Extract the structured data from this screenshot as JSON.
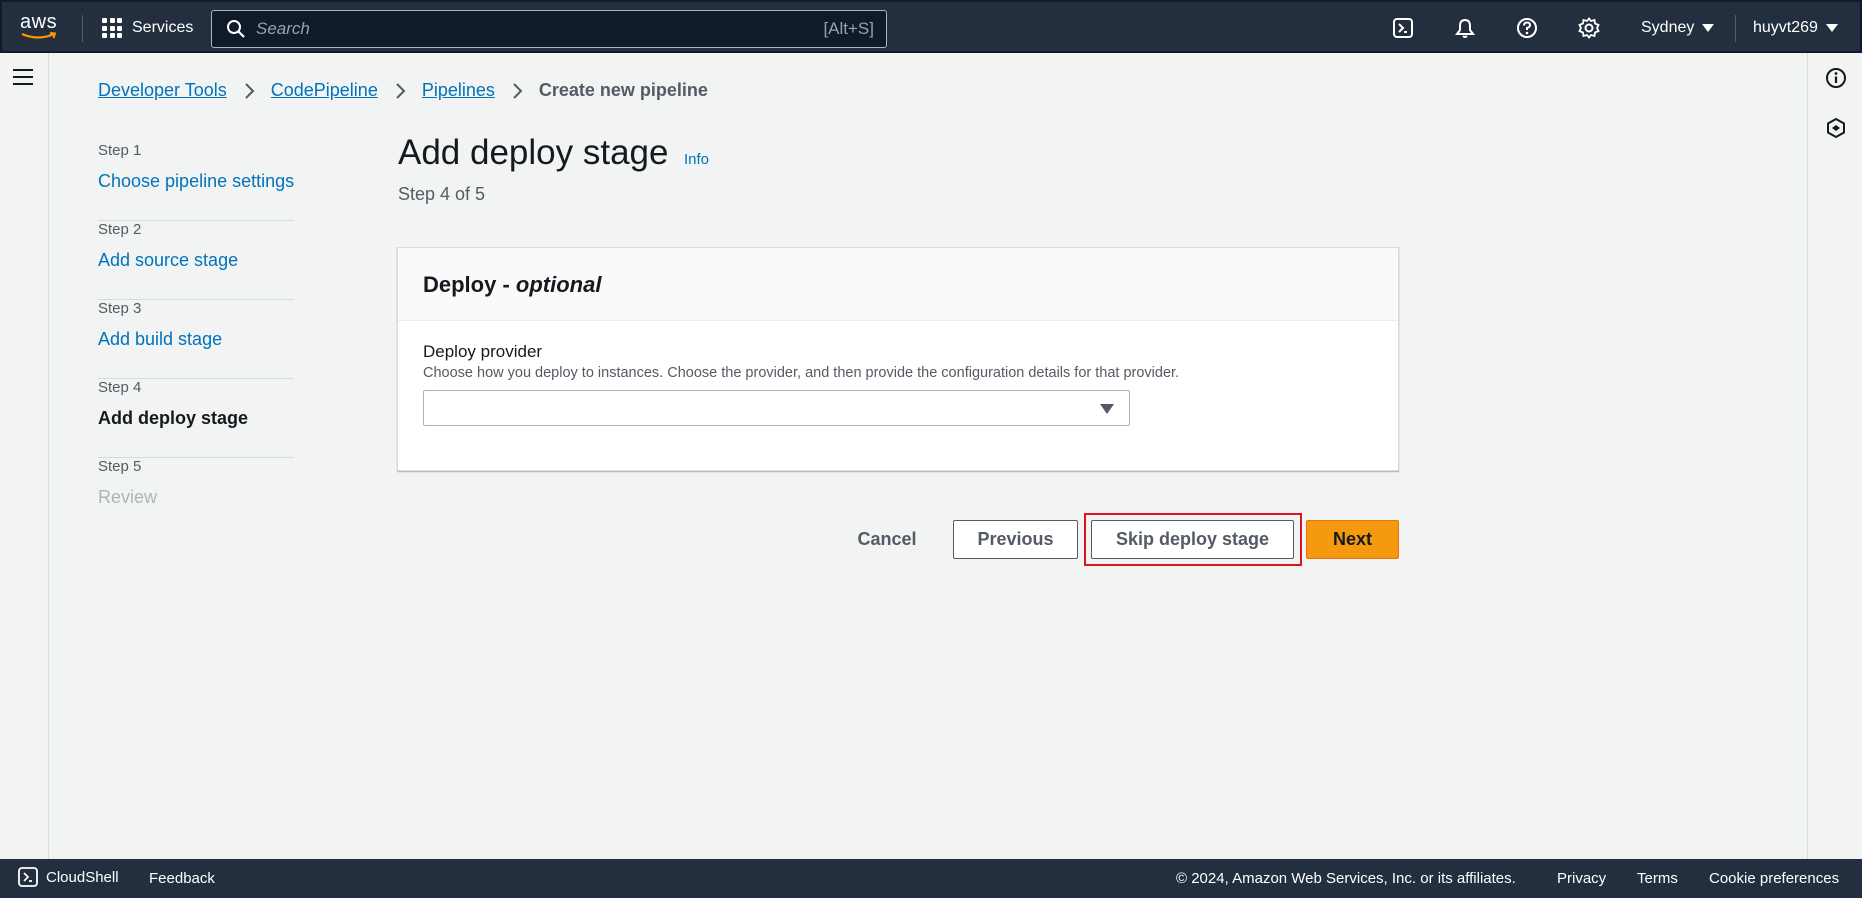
{
  "topnav": {
    "logo_text": "aws",
    "services_label": "Services",
    "search_placeholder": "Search",
    "search_shortcut": "[Alt+S]",
    "region": "Sydney",
    "user": "huyvt269"
  },
  "breadcrumb": {
    "items": [
      "Developer Tools",
      "CodePipeline",
      "Pipelines"
    ],
    "current": "Create new pipeline"
  },
  "steps": [
    {
      "num": "Step 1",
      "label": "Choose pipeline settings",
      "state": "link"
    },
    {
      "num": "Step 2",
      "label": "Add source stage",
      "state": "link"
    },
    {
      "num": "Step 3",
      "label": "Add build stage",
      "state": "link"
    },
    {
      "num": "Step 4",
      "label": "Add deploy stage",
      "state": "active"
    },
    {
      "num": "Step 5",
      "label": "Review",
      "state": "disabled"
    }
  ],
  "page": {
    "title": "Add deploy stage",
    "info": "Info",
    "step_of": "Step 4 of 5"
  },
  "panel": {
    "title_main": "Deploy - ",
    "title_em": "optional",
    "field_label": "Deploy provider",
    "field_desc": "Choose how you deploy to instances. Choose the provider, and then provide the configuration details for that provider.",
    "select_value": ""
  },
  "actions": {
    "cancel": "Cancel",
    "previous": "Previous",
    "skip": "Skip deploy stage",
    "next": "Next"
  },
  "footer": {
    "cloudshell": "CloudShell",
    "feedback": "Feedback",
    "copyright": "© 2024, Amazon Web Services, Inc. or its affiliates.",
    "privacy": "Privacy",
    "terms": "Terms",
    "cookies": "Cookie preferences"
  },
  "colors": {
    "nav_bg": "#232f3e",
    "link": "#0073bb",
    "primary_button": "#f59a0e",
    "highlight": "#e0121f"
  }
}
